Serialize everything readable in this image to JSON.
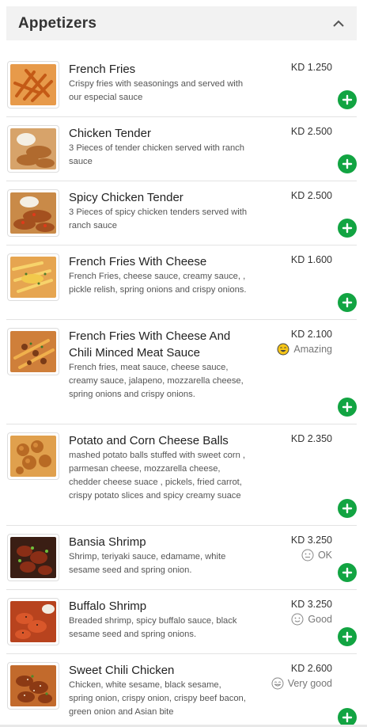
{
  "section": {
    "title": "Appetizers",
    "collapse_icon": "chevron-up-icon"
  },
  "colors": {
    "add_button": "#12a442",
    "amazing_face": "#f5c518",
    "header_bg": "#f2f2f2"
  },
  "items": [
    {
      "name": "French Fries",
      "description": "Crispy fries with seasonings and served with our especial sauce",
      "price": "KD 1.250",
      "rating": ""
    },
    {
      "name": "Chicken Tender",
      "description": "3 Pieces of tender chicken served with ranch sauce",
      "price": "KD 2.500",
      "rating": ""
    },
    {
      "name": "Spicy Chicken Tender",
      "description": "3 Pieces of spicy chicken tenders served with ranch sauce",
      "price": "KD 2.500",
      "rating": ""
    },
    {
      "name": "French Fries With Cheese",
      "description": "French Fries, cheese sauce, creamy sauce, , pickle relish, spring onions and crispy onions.",
      "price": "KD 1.600",
      "rating": ""
    },
    {
      "name": "French Fries With Cheese And Chili Minced Meat Sauce",
      "description": "French fries, meat sauce, cheese sauce, creamy sauce, jalapeno, mozzarella cheese, spring onions and crispy onions.",
      "price": "KD 2.100",
      "rating": "Amazing"
    },
    {
      "name": "Potato and Corn Cheese Balls",
      "description": "mashed potato balls stuffed with sweet corn , parmesan cheese, mozzarella cheese, chedder cheese suace , pickels, fried carrot, crispy potato slices and spicy creamy suace",
      "price": "KD 2.350",
      "rating": ""
    },
    {
      "name": "Bansia Shrimp",
      "description": "Shrimp, teriyaki sauce, edamame, white sesame seed and spring onion.",
      "price": "KD 3.250",
      "rating": "OK"
    },
    {
      "name": "Buffalo Shrimp",
      "description": "Breaded shrimp, spicy buffalo sauce, black sesame seed and spring onions.",
      "price": "KD 3.250",
      "rating": "Good"
    },
    {
      "name": "Sweet Chili Chicken",
      "description": "Chicken, white sesame, black sesame, spring onion, crispy onion, crispy beef bacon, green onion and Asian bite",
      "price": "KD 2.600",
      "rating": "Very good"
    }
  ]
}
